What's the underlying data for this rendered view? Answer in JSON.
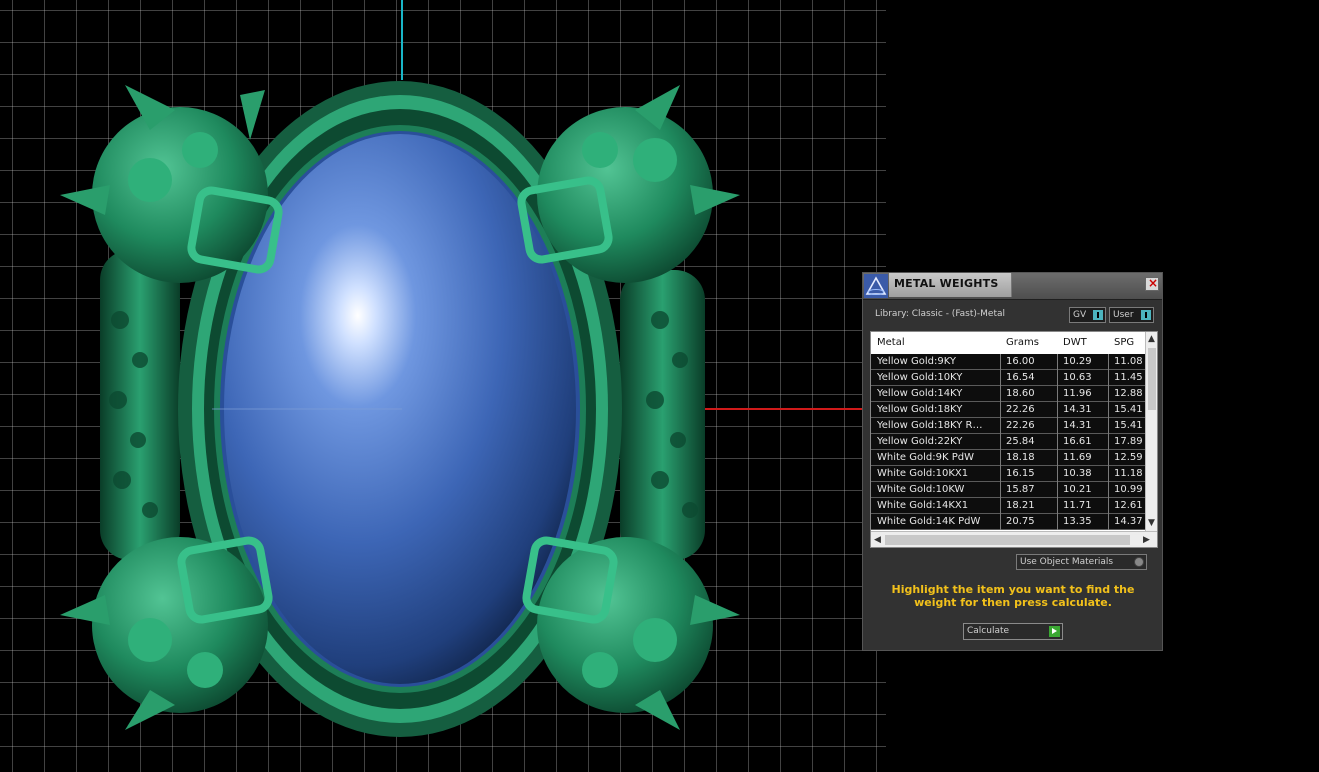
{
  "window": {
    "title": "METAL WEIGHTS"
  },
  "library": {
    "label": "Library: Classic - (Fast)-Metal"
  },
  "toggles": {
    "gv": "GV",
    "user": "User"
  },
  "table": {
    "columns": [
      "Metal",
      "Grams",
      "DWT",
      "SPG"
    ],
    "rows": [
      [
        "Yellow Gold:9KY",
        "16.00",
        "10.29",
        "11.08"
      ],
      [
        "Yellow Gold:10KY",
        "16.54",
        "10.63",
        "11.45"
      ],
      [
        "Yellow Gold:14KY",
        "18.60",
        "11.96",
        "12.88"
      ],
      [
        "Yellow Gold:18KY",
        "22.26",
        "14.31",
        "15.41"
      ],
      [
        "Yellow Gold:18KY R…",
        "22.26",
        "14.31",
        "15.41"
      ],
      [
        "Yellow Gold:22KY",
        "25.84",
        "16.61",
        "17.89"
      ],
      [
        "White Gold:9K PdW",
        "18.18",
        "11.69",
        "12.59"
      ],
      [
        "White Gold:10KX1",
        "16.15",
        "10.38",
        "11.18"
      ],
      [
        "White Gold:10KW",
        "15.87",
        "10.21",
        "10.99"
      ],
      [
        "White Gold:14KX1",
        "18.21",
        "11.71",
        "12.61"
      ],
      [
        "White Gold:14K PdW",
        "20.75",
        "13.35",
        "14.37"
      ]
    ]
  },
  "options": {
    "use_object_materials": "Use Object Materials"
  },
  "hint": "Highlight the item you want to find the weight for then press calculate.",
  "actions": {
    "calculate": "Calculate"
  },
  "colors": {
    "hint_text": "#f2c11b",
    "model_green": "#1f8a5e",
    "gem_blue": "#3e6fc2",
    "axis_red": "#d01a1a",
    "axis_cyan": "#19b6c8"
  }
}
